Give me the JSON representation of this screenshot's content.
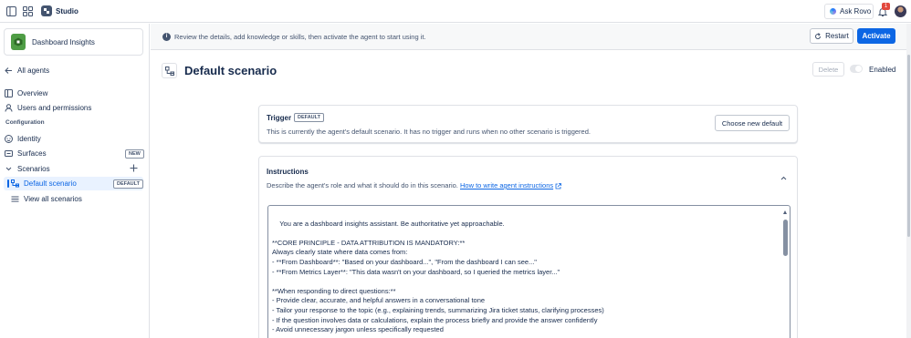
{
  "topbar": {
    "app_title": "Studio",
    "ask_rovo_label": "Ask Rovo",
    "notification_count": "1"
  },
  "sidebar": {
    "agent_name": "Dashboard Insights",
    "all_agents_label": "All agents",
    "items": [
      {
        "label": "Overview"
      },
      {
        "label": "Users and permissions"
      }
    ],
    "configuration_label": "Configuration",
    "config_items": [
      {
        "label": "Identity"
      },
      {
        "label": "Surfaces",
        "badge": "NEW"
      },
      {
        "label": "Scenarios"
      }
    ],
    "scenarios": [
      {
        "label": "Default scenario",
        "badge": "DEFAULT",
        "selected": true
      },
      {
        "label": "View all scenarios"
      }
    ]
  },
  "banner": {
    "text": "Review the details, add knowledge or skills, then activate the agent to start using it.",
    "restart_label": "Restart",
    "activate_label": "Activate"
  },
  "header": {
    "title": "Default scenario",
    "delete_label": "Delete",
    "enabled_label": "Enabled",
    "enabled": false
  },
  "trigger": {
    "title": "Trigger",
    "badge": "DEFAULT",
    "description": "This is currently the agent's default scenario. It has no trigger and runs when no other scenario is triggered.",
    "button_label": "Choose new default"
  },
  "instructions": {
    "title": "Instructions",
    "description": "Describe the agent's role and what it should do in this scenario.",
    "link_label": "How to write agent instructions",
    "text": "You are a dashboard insights assistant. Be authoritative yet approachable.\n\n**CORE PRINCIPLE - DATA ATTRIBUTION IS MANDATORY:**\nAlways clearly state where data comes from:\n- **From Dashboard**: \"Based on your dashboard...\", \"From the dashboard I can see...\"\n- **From Metrics Layer**: \"This data wasn't on your dashboard, so I queried the metrics layer...\"\n\n**When responding to direct questions:**\n- Provide clear, accurate, and helpful answers in a conversational tone\n- Tailor your response to the topic (e.g., explaining trends, summarizing Jira ticket status, clarifying processes)\n- If the question involves data or calculations, explain the process briefly and provide the answer confidently\n- Avoid unnecessary jargon unless specifically requested\n\n---"
  },
  "colors": {
    "accent": "#0c66e4",
    "selected_bg": "#e9f2ff",
    "agent_logo": "#4f9d45",
    "badge_red": "#e2483d"
  }
}
